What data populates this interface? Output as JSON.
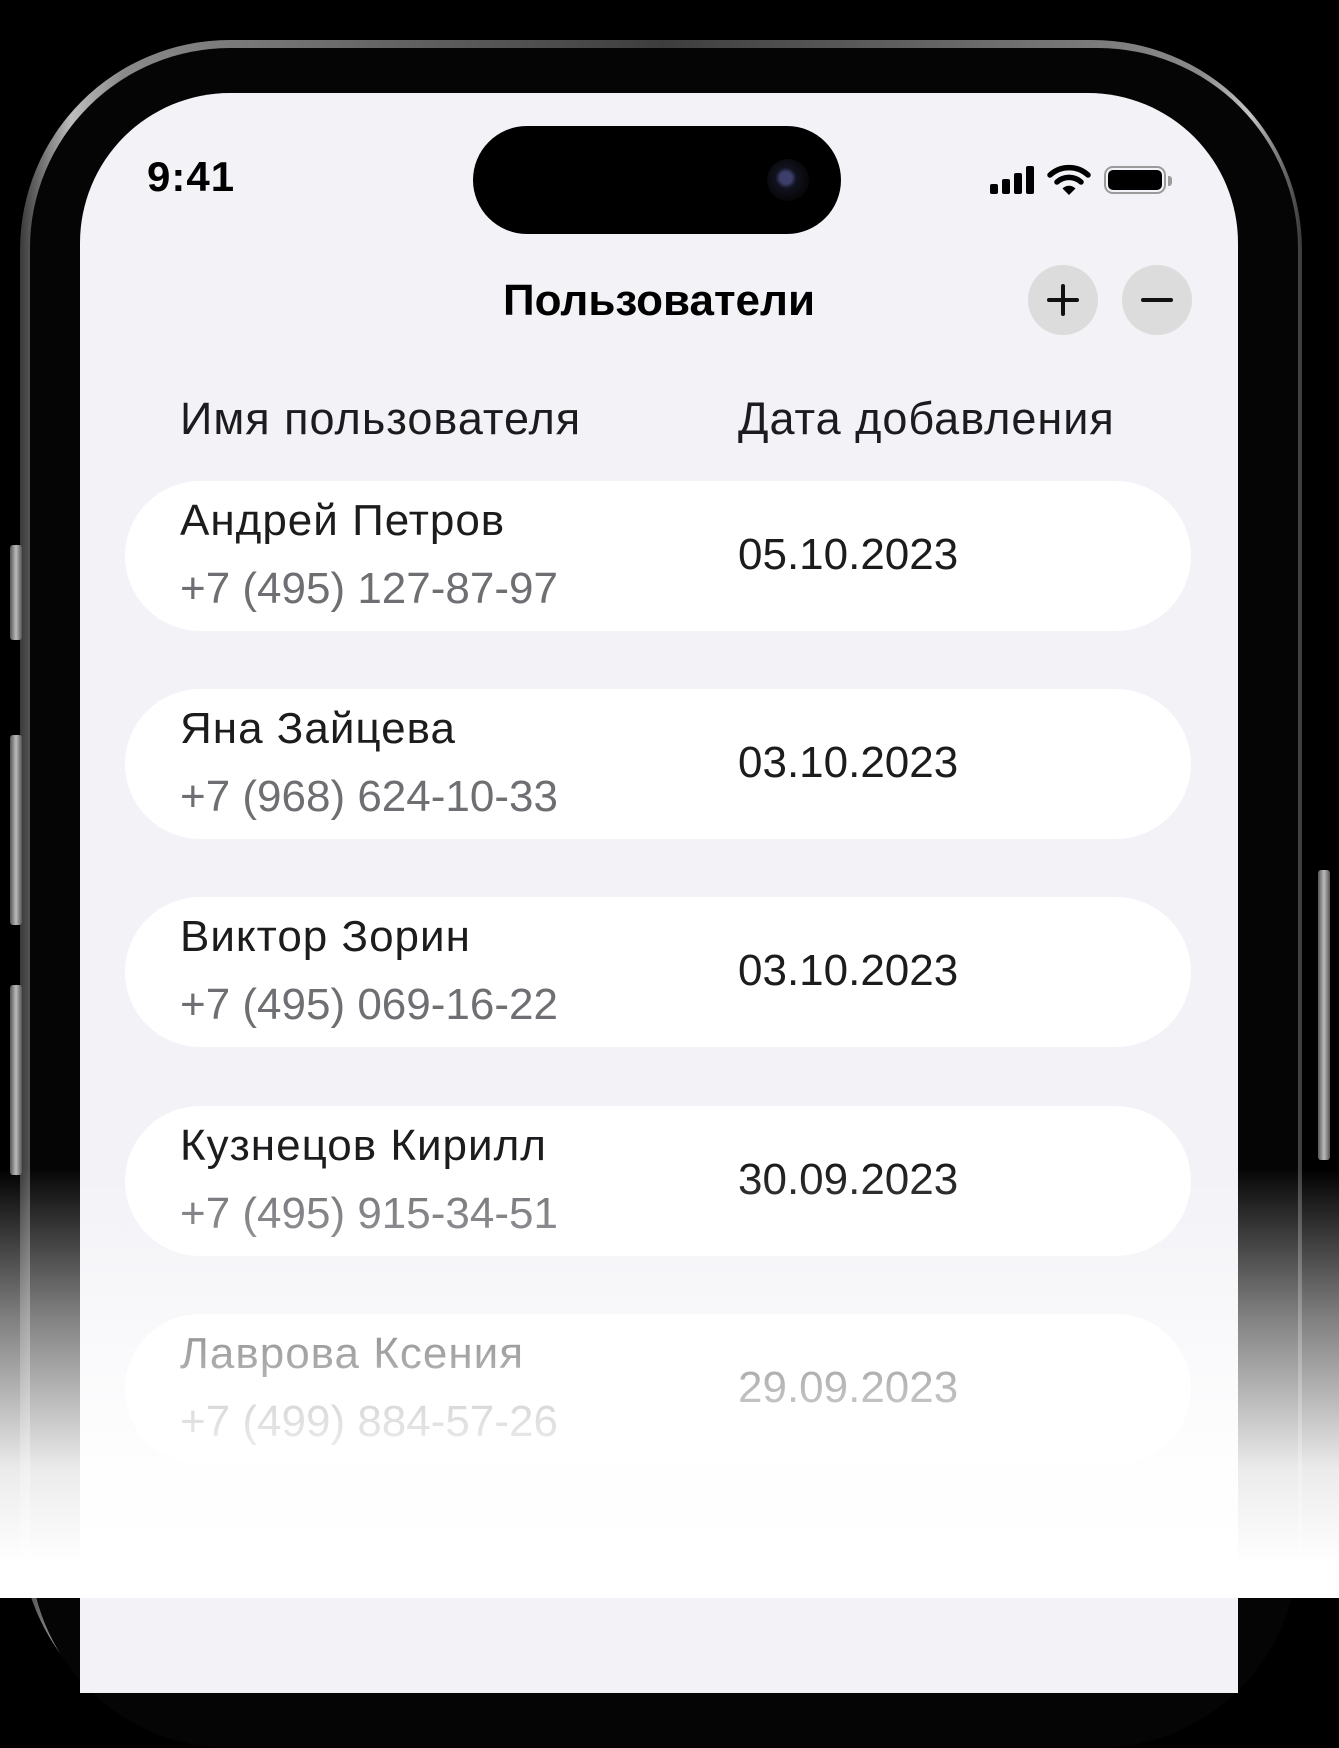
{
  "status_bar": {
    "time": "9:41"
  },
  "header": {
    "title": "Пользователи",
    "add_label": "+",
    "remove_label": "−"
  },
  "columns": {
    "name": "Имя пользователя",
    "date": "Дата добавления"
  },
  "users": [
    {
      "name": "Андрей Петров",
      "phone": "+7 (495) 127-87-97",
      "date": "05.10.2023"
    },
    {
      "name": "Яна Зайцева",
      "phone": "+7 (968) 624-10-33",
      "date": "03.10.2023"
    },
    {
      "name": "Виктор Зорин",
      "phone": "+7 (495) 069-16-22",
      "date": "03.10.2023"
    },
    {
      "name": "Кузнецов Кирилл",
      "phone": "+7 (495) 915-34-51",
      "date": "30.09.2023"
    },
    {
      "name": "Лаврова Ксения",
      "phone": "+7 (499) 884-57-26",
      "date": "29.09.2023"
    }
  ],
  "colors": {
    "screen_background": "#f2f2f7",
    "row_background": "#ffffff",
    "button_background": "#dcdcdc",
    "secondary_text": "#6e6e73"
  }
}
